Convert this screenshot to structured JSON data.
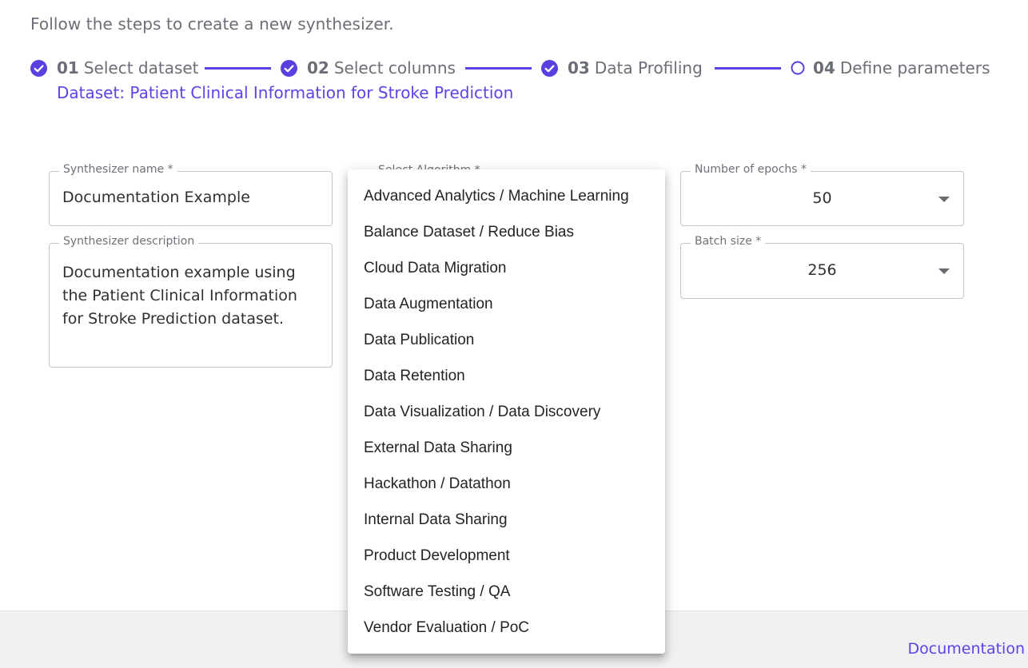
{
  "intro_text": "Follow the steps to create a new synthesizer.",
  "stepper": {
    "steps": [
      {
        "number": "01",
        "label": "Select dataset",
        "status": "complete"
      },
      {
        "number": "02",
        "label": "Select columns",
        "status": "complete"
      },
      {
        "number": "03",
        "label": "Data Profiling",
        "status": "complete"
      },
      {
        "number": "04",
        "label": "Define parameters",
        "status": "current"
      }
    ],
    "accent_color": "#5b3fe0"
  },
  "dataset_line": "Dataset: Patient Clinical Information for Stroke Prediction",
  "form": {
    "synth_name": {
      "label": "Synthesizer name *",
      "value": "Documentation Example"
    },
    "synth_description": {
      "label": "Synthesizer description",
      "value": "Documentation example using the Patient Clinical Information for Stroke Prediction dataset."
    },
    "algorithm": {
      "label": "Select Algorithm *"
    },
    "epochs": {
      "label": "Number of epochs *",
      "value": "50"
    },
    "batch_size": {
      "label": "Batch size *",
      "value": "256"
    }
  },
  "dropdown_menu": {
    "items": [
      "Advanced Analytics / Machine Learning",
      "Balance Dataset / Reduce Bias",
      "Cloud Data Migration",
      "Data Augmentation",
      "Data Publication",
      "Data Retention",
      "Data Visualization / Data Discovery",
      "External Data Sharing",
      "Hackathon / Datathon",
      "Internal Data Sharing",
      "Product Development",
      "Software Testing / QA",
      "Vendor Evaluation / PoC"
    ]
  },
  "footer": {
    "documentation_link": "Documentation"
  }
}
